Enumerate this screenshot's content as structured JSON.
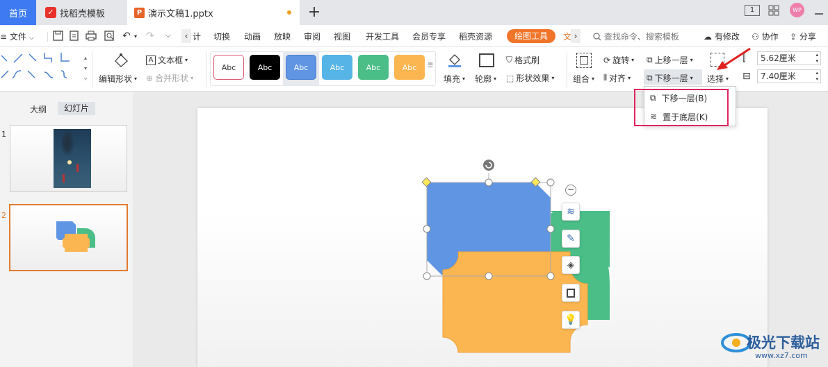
{
  "tabs": {
    "home": "首页",
    "template": "找稻壳模板",
    "document": "演示文稿1.pptx",
    "add": "+"
  },
  "window": {
    "avatar": "WP",
    "layout_label": "1"
  },
  "menu": {
    "file": "文件",
    "items_left_cut": "计",
    "items": [
      "切换",
      "动画",
      "放映",
      "审阅",
      "视图",
      "开发工具",
      "会员专享",
      "稻壳资源"
    ],
    "drawing_tools": "绘图工具",
    "text_tools_cut": "文",
    "search_placeholder": "查找命令、搜索模板",
    "has_changes": "有修改",
    "collaborate": "协作",
    "share": "分享"
  },
  "ribbon": {
    "edit_shape": "编辑形状",
    "text_box": "文本框",
    "merge_shapes": "合并形状",
    "style_label": "Abc",
    "fill": "填充",
    "outline": "轮廓",
    "format_painter": "格式刷",
    "shape_effects": "形状效果",
    "rotate": "旋转",
    "align": "对齐",
    "group": "组合",
    "bring_forward": "上移一层",
    "send_backward": "下移一层",
    "select": "选择",
    "width": "5.62厘米",
    "height": "7.40厘米"
  },
  "dropdown": {
    "send_backward": "下移一层(B)",
    "send_to_back": "置于底层(K)"
  },
  "panel": {
    "outline_tab": "大纲",
    "slides_tab": "幻灯片",
    "slide1_number": "1",
    "slide2_number": "2"
  },
  "watermark": {
    "brand": "极光下载站",
    "url": "www.xz7.com"
  },
  "colors": {
    "accent_blue": "#3e7bf2",
    "drawing_tools_orange": "#f0742a",
    "shape_blue": "#5f95e3",
    "shape_green": "#4bbd87",
    "shape_orange": "#fbb652",
    "highlight_red": "#e0245e",
    "slide_border_selected": "#e07a30"
  }
}
